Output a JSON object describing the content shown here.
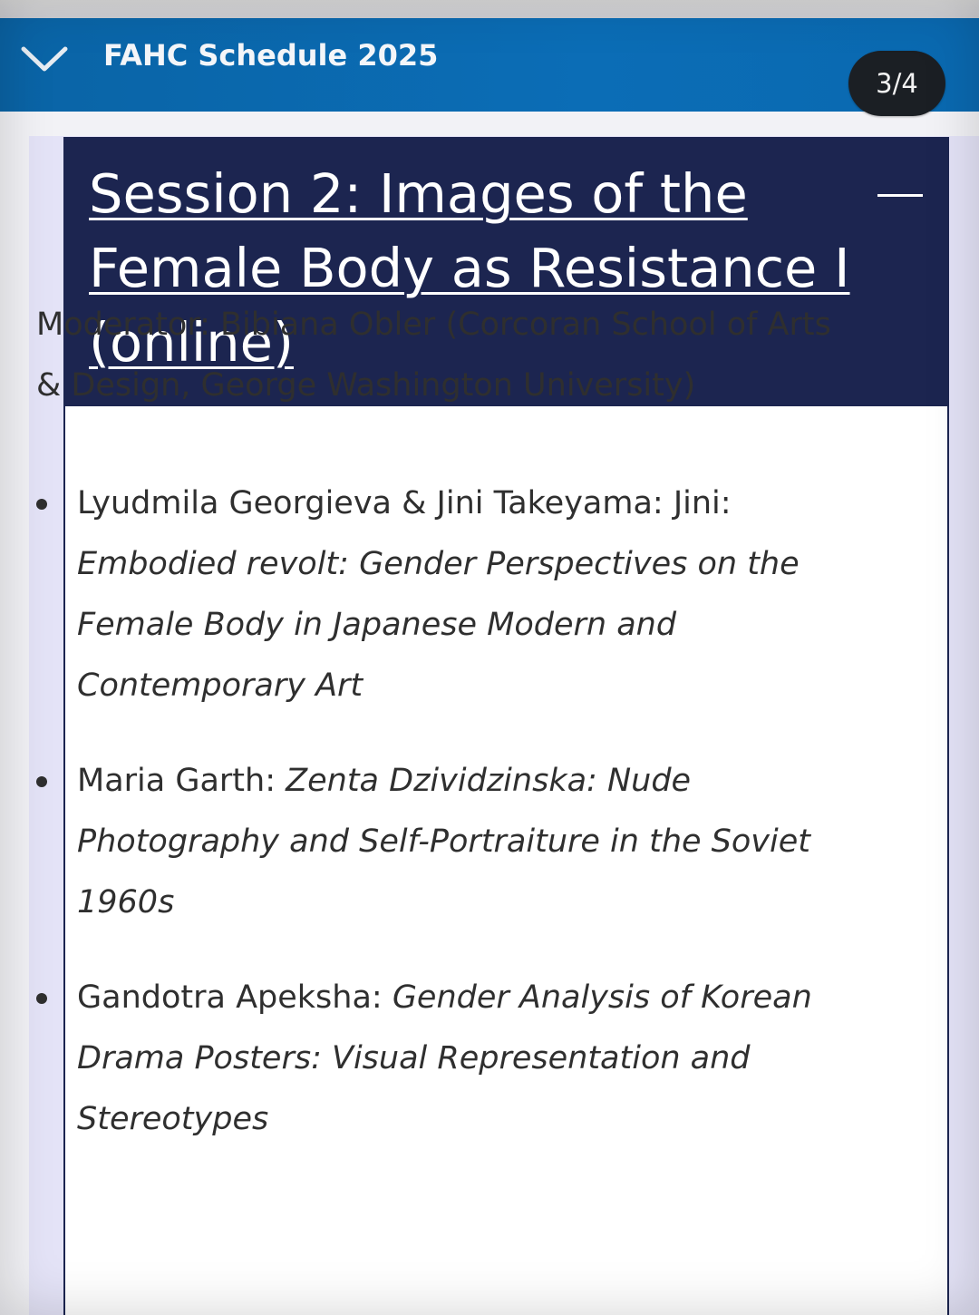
{
  "header": {
    "title": "FAHC Schedule 2025",
    "page_indicator": "3/4",
    "chevron_icon": "chevron-down-icon"
  },
  "session": {
    "title": "Session 2: Images of the Female Body as Resistance I (online)",
    "collapse_icon": "minus-icon",
    "moderator": "Moderator: Bibiana Obler (Corcoran School of Arts & Design, George Washington University)",
    "papers": [
      {
        "speaker": "Lyudmila Georgieva & Jini Takeyama: Jini: ",
        "title": "Embodied revolt: Gender Perspectives on the Female Body in Japanese Modern and Contemporary Art"
      },
      {
        "speaker": "Maria Garth: ",
        "title": "Zenta Dzividzinska: Nude Photography and Self-Portraiture in the Soviet 1960s"
      },
      {
        "speaker": "Gandotra Apeksha: ",
        "title": "Gender Analysis of Korean Drama Posters: Visual Representation and Stereotypes"
      }
    ]
  },
  "colors": {
    "header_blue": "#0b6db6",
    "card_navy": "#1c2550",
    "badge_dark": "#1b1f24",
    "side_lavender": "#e4e3f7"
  }
}
